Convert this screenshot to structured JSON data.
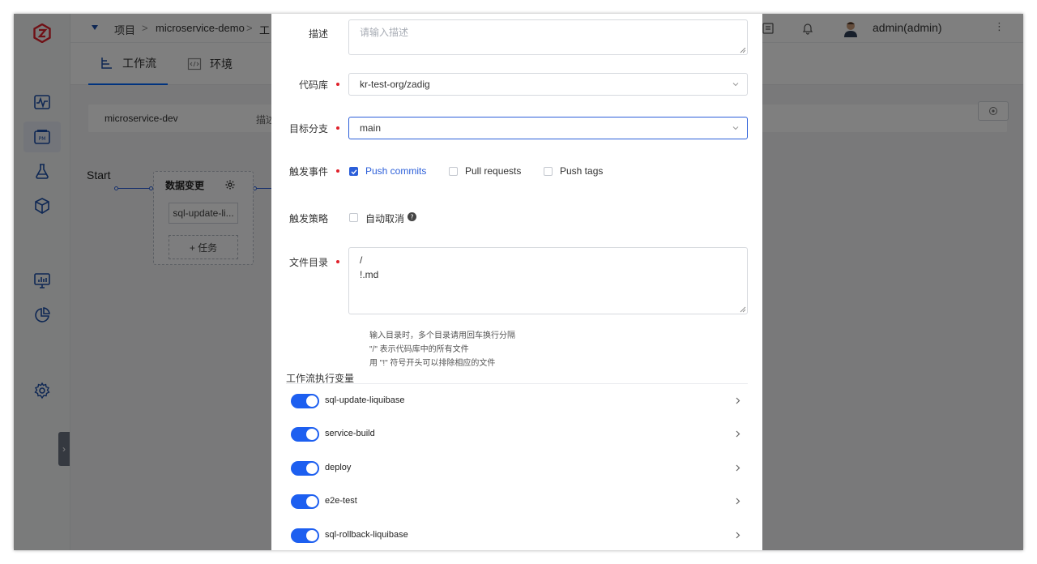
{
  "topbar": {
    "breadcrumb": [
      "项目",
      "microservice-demo",
      "工"
    ],
    "separator": ">",
    "user": "admin(admin)"
  },
  "tabs": [
    {
      "label": "工作流",
      "icon": "workflow-icon",
      "active": true
    },
    {
      "label": "环境",
      "icon": "code-icon",
      "active": false
    }
  ],
  "workflow": {
    "name": "microservice-dev",
    "desc_label": "描述",
    "start_label": "Start",
    "stage_title": "数据变更",
    "job_chip": "sql-update-li...",
    "add_task": "+ 任务"
  },
  "dialog": {
    "desc_label": "描述",
    "desc_placeholder": "请输入描述",
    "repo_label": "代码库",
    "repo_value": "kr-test-org/zadig",
    "branch_label": "目标分支",
    "branch_value": "main",
    "event_label": "触发事件",
    "events": [
      {
        "label": "Push commits",
        "checked": true
      },
      {
        "label": "Pull requests",
        "checked": false
      },
      {
        "label": "Push tags",
        "checked": false
      }
    ],
    "strategy_label": "触发策略",
    "auto_cancel_label": "自动取消",
    "dir_label": "文件目录",
    "dir_lines": [
      "/",
      "!.md"
    ],
    "help_lines": [
      "输入目录时，多个目录请用回车换行分隔",
      "\"/\" 表示代码库中的所有文件",
      "用 \"!\" 符号开头可以排除相应的文件"
    ],
    "vars_title": "工作流执行变量",
    "jobs": [
      {
        "name": "sql-update-liquibase",
        "enabled": true
      },
      {
        "name": "service-build",
        "enabled": true
      },
      {
        "name": "deploy",
        "enabled": true
      },
      {
        "name": "e2e-test",
        "enabled": true
      },
      {
        "name": "sql-rollback-liquibase",
        "enabled": true
      }
    ]
  },
  "colors": {
    "accent": "#2c5fd9",
    "switch_on": "#1d5ff0",
    "required": "#e0202a",
    "logo": "#e0202a"
  }
}
